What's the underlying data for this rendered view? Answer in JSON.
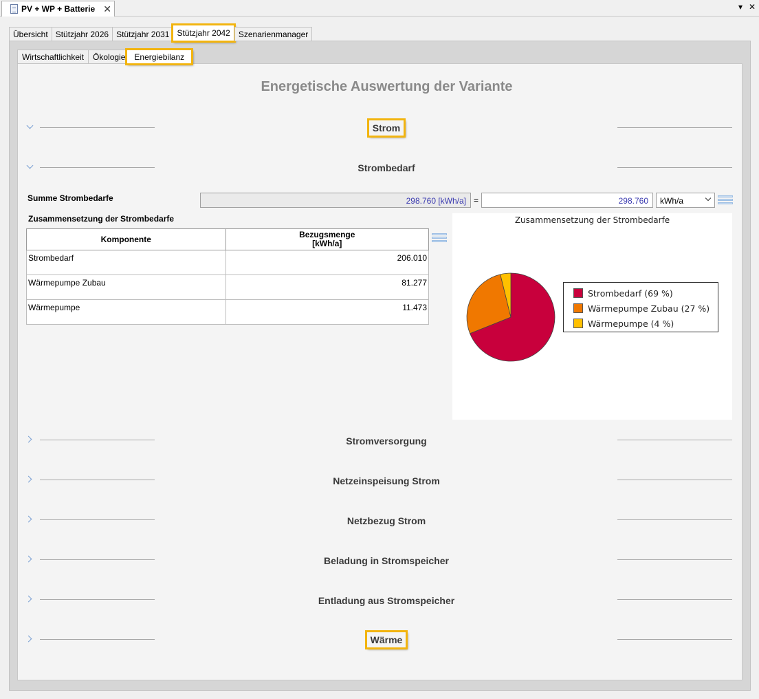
{
  "doc_tab": {
    "title": "PV + WP + Batterie",
    "close": "✕"
  },
  "window_controls": {
    "menu": "▾",
    "close": "✕"
  },
  "outer_tabs": [
    {
      "label": "Übersicht"
    },
    {
      "label": "Stützjahr 2026"
    },
    {
      "label": "Stützjahr 2031"
    },
    {
      "label": "Stützjahr 2042"
    },
    {
      "label": "Szenarienmanager"
    }
  ],
  "inner_tabs": [
    {
      "label": "Wirtschaftlichkeit"
    },
    {
      "label": "Ökologie"
    },
    {
      "label": "Energiebilanz"
    }
  ],
  "main_title": "Energetische Auswertung der Variante",
  "sections": {
    "strom": "Strom",
    "strombedarf": "Strombedarf",
    "stromversorgung": "Stromversorgung",
    "netzeinspeisung": "Netzeinspeisung Strom",
    "netzbezug": "Netzbezug Strom",
    "beladung": "Beladung in Stromspeicher",
    "entladung": "Entladung aus Stromspeicher",
    "waerme": "Wärme"
  },
  "summe": {
    "label": "Summe Strombedarfe",
    "readonly_value": "298.760 [kWh/a]",
    "equals": "=",
    "value": "298.760",
    "unit": "kWh/a"
  },
  "table": {
    "title": "Zusammensetzung der Strombedarfe",
    "headers": [
      "Komponente",
      "Bezugsmenge",
      "[kWh/a]"
    ],
    "rows": [
      {
        "name": "Strombedarf",
        "value": "206.010"
      },
      {
        "name": "Wärmepumpe Zubau",
        "value": "81.277"
      },
      {
        "name": "Wärmepumpe",
        "value": "11.473"
      }
    ]
  },
  "chart_data": {
    "type": "pie",
    "title": "Zusammensetzung der Strombedarfe",
    "categories": [
      "Strombedarf",
      "Wärmepumpe Zubau",
      "Wärmepumpe"
    ],
    "values": [
      206010,
      81277,
      11473
    ],
    "legend_labels": [
      "Strombedarf (69 %)",
      "Wärmepumpe Zubau (27 %)",
      "Wärmepumpe (4 %)"
    ],
    "colors": [
      "#c8003c",
      "#f07800",
      "#ffc000"
    ],
    "legend": "right"
  }
}
